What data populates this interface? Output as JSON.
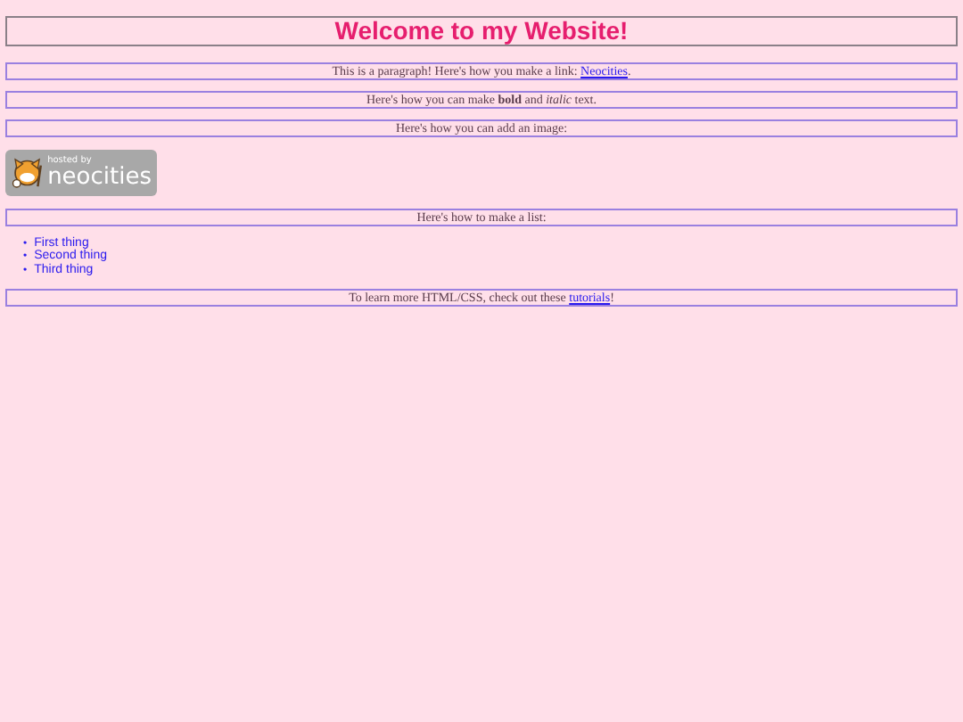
{
  "heading": "Welcome to my Website!",
  "blocks": [
    {
      "kind": "paragraph",
      "before": "This is a paragraph! Here's how you make a link: ",
      "link": "Neocities",
      "after": "."
    },
    {
      "kind": "paragraph",
      "before": "Here's how you can make **bold** and *italic* text."
    },
    {
      "kind": "paragraph",
      "before": "Here's how you can add an image:"
    },
    {
      "kind": "badge",
      "small": "hosted by",
      "big": "neocities"
    },
    {
      "kind": "paragraph",
      "before": "Here's how to make a list:"
    },
    {
      "kind": "list",
      "marker": "•",
      "items": [
        "First thing",
        "Second thing",
        "Third thing"
      ]
    },
    {
      "kind": "paragraph",
      "before": "To learn more HTML/CSS, check out these ",
      "link": "tutorials",
      "after": "!"
    }
  ]
}
